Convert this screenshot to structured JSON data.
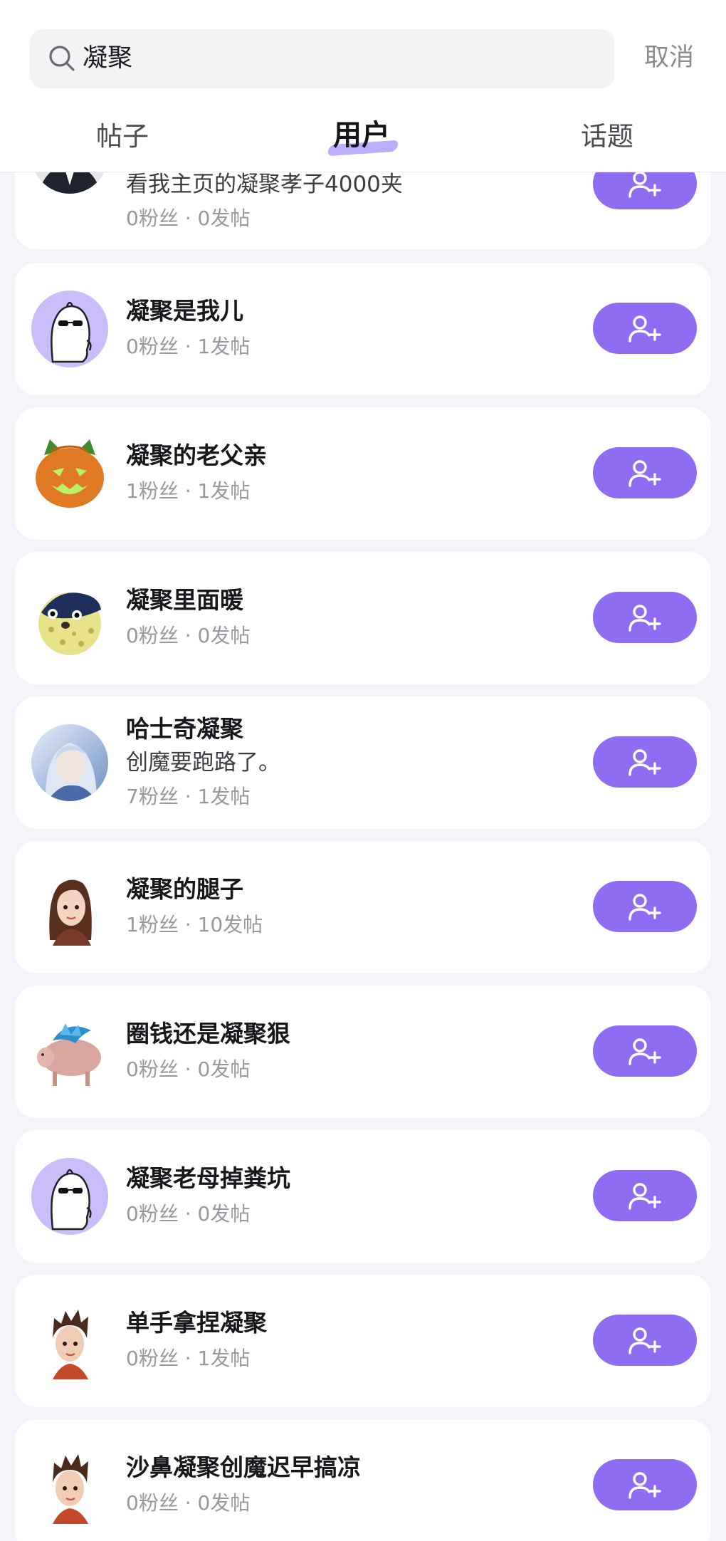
{
  "search": {
    "query": "凝聚",
    "cancel_label": "取消"
  },
  "tabs": [
    {
      "label": "帖子",
      "active": false
    },
    {
      "label": "用户",
      "active": true
    },
    {
      "label": "话题",
      "active": false
    }
  ],
  "colors": {
    "accent": "#8f6cf2",
    "tab_highlight": "#b39dfb",
    "background": "#f3f5fa"
  },
  "users": [
    {
      "name": "",
      "bio": "看我主页的凝聚孝子4000夹",
      "stats": "0粉丝 · 0发帖",
      "avatar": "man-in-suit-photo"
    },
    {
      "name": "凝聚是我儿",
      "bio": "",
      "stats": "0粉丝 · 1发帖",
      "avatar": "ghost-sunglasses-default"
    },
    {
      "name": "凝聚的老父亲",
      "bio": "",
      "stats": "1粉丝 · 1发帖",
      "avatar": "pumpkin-cat"
    },
    {
      "name": "凝聚里面暖",
      "bio": "",
      "stats": "0粉丝 · 0发帖",
      "avatar": "pufferfish"
    },
    {
      "name": "哈士奇凝聚",
      "bio": "创魔要跑路了。",
      "stats": "7粉丝 · 1发帖",
      "avatar": "anime-girl-blue"
    },
    {
      "name": "凝聚的腿子",
      "bio": "",
      "stats": "1粉丝 · 10发帖",
      "avatar": "3d-girl-brown-hair"
    },
    {
      "name": "圈钱还是凝聚狠",
      "bio": "",
      "stats": "0粉丝 · 0发帖",
      "avatar": "pig-blue-mane"
    },
    {
      "name": "凝聚老母掉粪坑",
      "bio": "",
      "stats": "0粉丝 · 0发帖",
      "avatar": "ghost-sunglasses-default"
    },
    {
      "name": "单手拿捏凝聚",
      "bio": "",
      "stats": "0粉丝 · 1发帖",
      "avatar": "3d-boy-spiky-hair"
    },
    {
      "name": "沙鼻凝聚创魔迟早搞凉",
      "bio": "",
      "stats": "0粉丝 · 0发帖",
      "avatar": "3d-boy-spiky-hair"
    }
  ]
}
